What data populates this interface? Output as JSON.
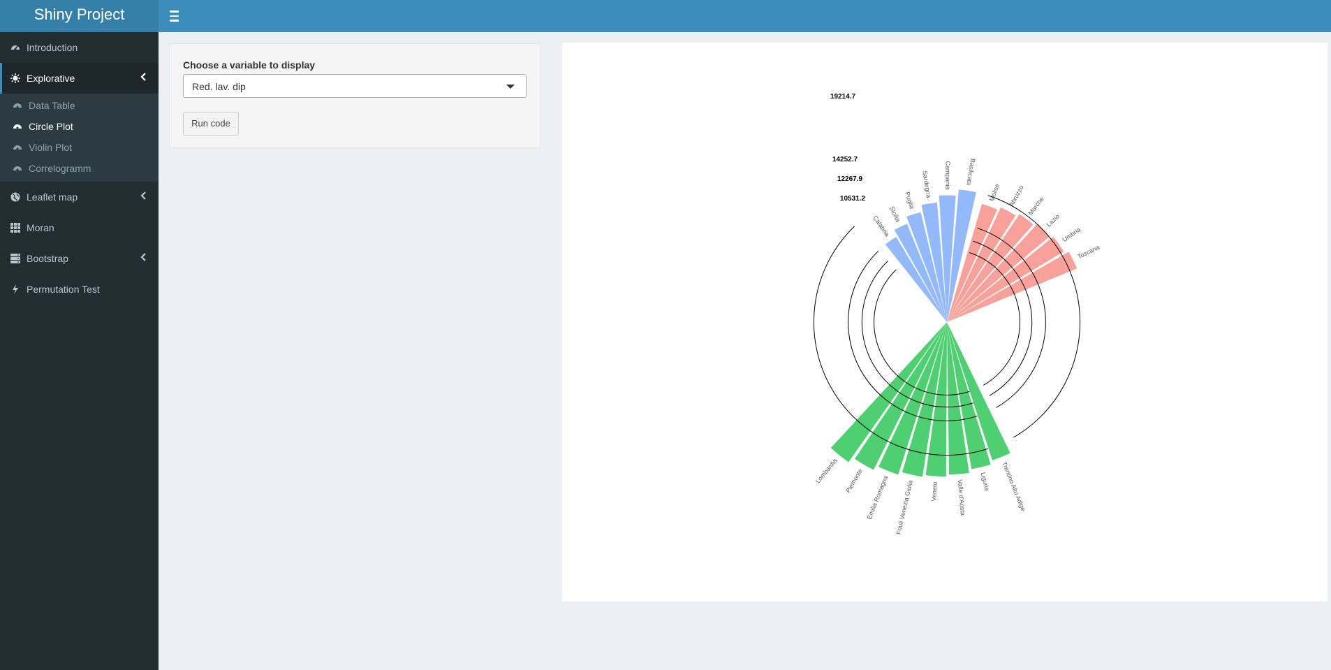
{
  "header": {
    "title": "Shiny Project"
  },
  "sidebar": {
    "items": [
      {
        "label": "Introduction",
        "icon": "dashboard-icon"
      },
      {
        "label": "Explorative",
        "icon": "sun-icon"
      },
      {
        "label": "Leaflet map",
        "icon": "globe-icon"
      },
      {
        "label": "Moran",
        "icon": "grid-icon"
      },
      {
        "label": "Bootstrap",
        "icon": "server-icon"
      },
      {
        "label": "Permutation Test",
        "icon": "bolt-icon"
      }
    ],
    "submenu": [
      {
        "label": "Data Table",
        "icon": "dashboard-icon"
      },
      {
        "label": "Circle Plot",
        "icon": "dashboard-icon"
      },
      {
        "label": "Violin Plot",
        "icon": "dashboard-icon"
      },
      {
        "label": "Correlogramm",
        "icon": "dashboard-icon"
      }
    ]
  },
  "input_panel": {
    "label": "Choose a variable to display",
    "selected": "Red. lav. dip",
    "run_label": "Run code"
  },
  "colors": {
    "header": "#3c8dbc",
    "sidebar": "#222d32",
    "red": "#f8a09a",
    "green": "#4dcf72",
    "blue": "#93b9fc"
  },
  "chart_data": {
    "type": "bar",
    "polar": true,
    "scale_labels": [
      "19214.7",
      "14252.7",
      "12267.9",
      "10531.2"
    ],
    "groups": [
      {
        "name": "",
        "color": "#f8a09a",
        "categories": [
          "Molise",
          "Abruzzo",
          "Marche",
          "Lazio",
          "Umbria",
          "Toscana"
        ],
        "values": [
          17800,
          18300,
          18800,
          19300,
          19700,
          20300
        ]
      },
      {
        "name": "",
        "color": "#4dcf72",
        "categories": [
          "Trentino Alto Adige",
          "Liguria",
          "Valle d'Aosta",
          "Veneto",
          "Friuli Venezia Giulia",
          "Emilia Romagna",
          "Piemonte",
          "Lombardia"
        ],
        "values": [
          21000,
          21500,
          22000,
          22300,
          22600,
          23100,
          23800,
          24700
        ]
      },
      {
        "name": "",
        "color": "#93b9fc",
        "categories": [
          "Calabria",
          "Sicilia",
          "Puglia",
          "Sardegna",
          "Campania",
          "Basilicata"
        ],
        "values": [
          14300,
          15300,
          16300,
          17300,
          18300,
          19200
        ]
      }
    ]
  }
}
